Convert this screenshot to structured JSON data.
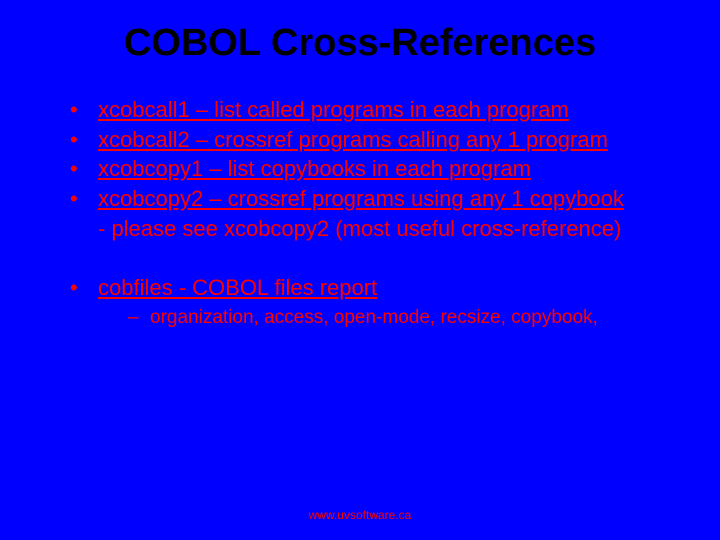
{
  "title": "COBOL Cross-References",
  "items": [
    {
      "link": "xcobcall1 – list called programs in each program",
      "tail": ""
    },
    {
      "link": "xcobcall2 – crossref programs calling any 1 program",
      "tail": ""
    },
    {
      "link": "xcobcopy1 – list copybooks in each program",
      "tail": ""
    },
    {
      "link": "xcobcopy2 – crossref programs using any 1 copybook",
      "tail": ""
    }
  ],
  "note": "- please see xcobcopy2  (most useful cross-reference)",
  "second": {
    "link": "cobfiles   - COBOL files report",
    "sub": "organization, access, open-mode, recsize, copybook,"
  },
  "footer": "www.uvsoftware.ca"
}
